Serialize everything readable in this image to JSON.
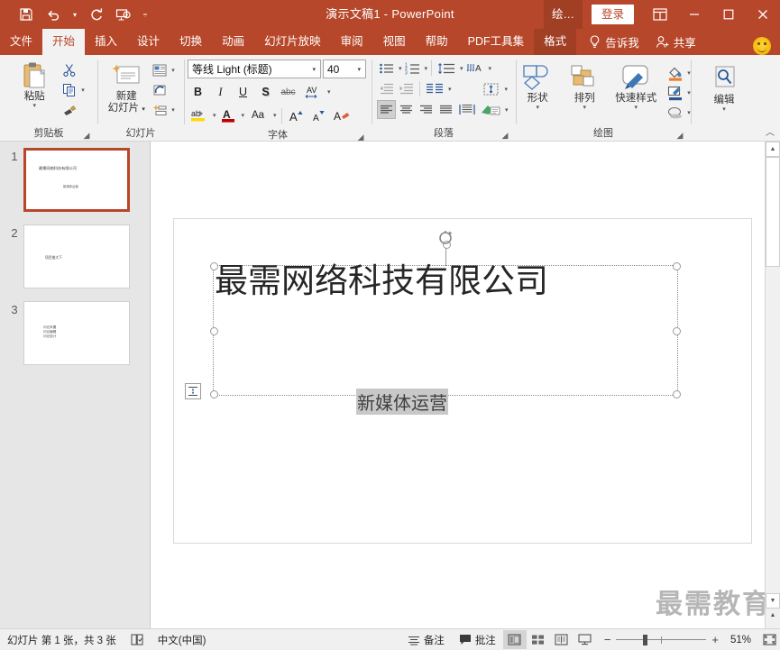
{
  "titlebar": {
    "document_title": "演示文稿1  -  PowerPoint",
    "quick_access": [
      {
        "name": "save",
        "icon": "save-icon"
      },
      {
        "name": "undo",
        "icon": "undo-icon"
      },
      {
        "name": "redo",
        "icon": "redo-icon"
      },
      {
        "name": "start-slideshow",
        "icon": "slideshow-icon"
      },
      {
        "name": "customize-qat",
        "icon": "chevron-down-icon"
      }
    ],
    "draw_tab_overflow": "绘…",
    "sign_in": "登录",
    "ribbon_display": "ribbon-display-options-icon",
    "minimize": "—",
    "maximize": "☐",
    "close": "✕"
  },
  "tabs": [
    {
      "label": "文件",
      "state": "normal"
    },
    {
      "label": "开始",
      "state": "active"
    },
    {
      "label": "插入",
      "state": "normal"
    },
    {
      "label": "设计",
      "state": "normal"
    },
    {
      "label": "切换",
      "state": "normal"
    },
    {
      "label": "动画",
      "state": "normal"
    },
    {
      "label": "幻灯片放映",
      "state": "normal"
    },
    {
      "label": "审阅",
      "state": "normal"
    },
    {
      "label": "视图",
      "state": "normal"
    },
    {
      "label": "帮助",
      "state": "normal"
    },
    {
      "label": "PDF工具集",
      "state": "normal"
    },
    {
      "label": "格式",
      "state": "contextual"
    }
  ],
  "tell_me": "告诉我",
  "share": "共享",
  "ribbon": {
    "clipboard": {
      "label": "剪贴板",
      "paste": "粘贴",
      "cut": "剪切",
      "copy": "复制",
      "format_painter": "格式刷"
    },
    "slides": {
      "label": "幻灯片",
      "new_slide_line1": "新建",
      "new_slide_line2": "幻灯片",
      "layout": "版式",
      "reset": "重置",
      "section": "节"
    },
    "font": {
      "label": "字体",
      "font_name": "等线 Light (标题)",
      "font_size": "40",
      "bold": "B",
      "italic": "I",
      "underline": "U",
      "shadow": "S",
      "strikethrough": "abc",
      "char_spacing": "AV",
      "text_highlight": "ab",
      "font_color": "A",
      "change_case": "Aa",
      "increase_size": "A",
      "decrease_size": "A",
      "clear_formatting": "clear-format-icon"
    },
    "paragraph": {
      "label": "段落",
      "bullets": "bullets-icon",
      "numbering": "numbering-icon",
      "line_spacing": "line-spacing-icon",
      "text_direction": "text-direction-icon",
      "decrease_indent": "decrease-indent-icon",
      "increase_indent": "increase-indent-icon",
      "columns": "columns-icon",
      "align_text": "align-text-icon",
      "align_left": "align-left-icon",
      "align_center": "align-center-icon",
      "align_right": "align-right-icon",
      "justify": "justify-icon",
      "smartart": "smartart-icon"
    },
    "drawing": {
      "label": "绘图",
      "shapes": "形状",
      "arrange": "排列",
      "quick_styles": "快速样式",
      "shape_fill": "shape-fill-icon",
      "shape_outline": "shape-outline-icon",
      "shape_effects": "shape-effects-icon"
    },
    "editing": {
      "label": "",
      "edit": "编辑"
    }
  },
  "thumbnails": [
    {
      "number": "1",
      "title": "最需网络科技有限公司",
      "subtitle": "新媒体运营",
      "selected": true
    },
    {
      "number": "2",
      "title": "项目推大下",
      "lines": [],
      "selected": false
    },
    {
      "number": "3",
      "title": "",
      "lines": [
        "问记本置",
        "问记编辑",
        "问记设计"
      ],
      "selected": false
    }
  ],
  "slide": {
    "title": "最需网络科技有限公司",
    "subtitle": "新媒体运营"
  },
  "watermark": "最需教育",
  "status": {
    "slide_count": "幻灯片 第 1 张，共 3 张",
    "accessibility_icon": "accessibility-icon",
    "language": "中文(中国)",
    "notes": "备注",
    "comments": "批注",
    "view_normal": "normal-view-icon",
    "view_sorter": "slide-sorter-icon",
    "view_reading": "reading-view-icon",
    "view_slideshow": "slideshow-view-icon",
    "zoom_out": "−",
    "zoom_in": "+",
    "zoom_level": "51%",
    "fit_to_window": "fit-slide-icon"
  },
  "colors": {
    "accent": "#b7472a",
    "accent_dark": "#a13f25",
    "ribbon_bg": "#f2f2f2",
    "panel_bg": "#e6e6e6"
  }
}
